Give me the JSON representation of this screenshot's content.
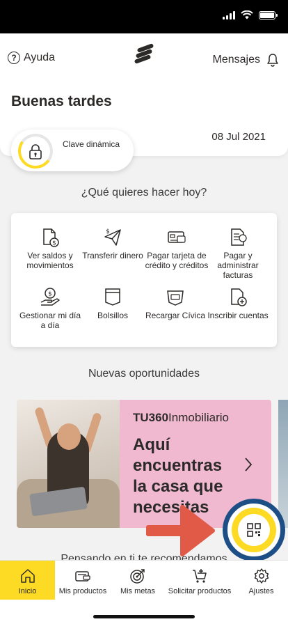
{
  "header": {
    "help_label": "Ayuda",
    "messages_label": "Mensajes",
    "greeting": "Buenas tardes",
    "date": "08 Jul 2021",
    "clave_label": "Clave dinámica"
  },
  "question": "¿Qué quieres hacer hoy?",
  "actions": [
    {
      "label": "Ver saldos y movimientos",
      "icon": "document-coin-icon"
    },
    {
      "label": "Transferir dinero",
      "icon": "paper-plane-icon"
    },
    {
      "label": "Pagar tarjeta de crédito y créditos",
      "icon": "credit-card-icon"
    },
    {
      "label": "Pagar y administrar facturas",
      "icon": "invoice-icon"
    },
    {
      "label": "Gestionar mi día a día",
      "icon": "hand-coin-icon"
    },
    {
      "label": "Bolsillos",
      "icon": "pocket-icon"
    },
    {
      "label": "Recargar Cívica",
      "icon": "civica-card-icon"
    },
    {
      "label": "Inscribir cuentas",
      "icon": "document-add-icon"
    }
  ],
  "oportunidades_title": "Nuevas oportunidades",
  "promo": {
    "brand_bold": "TU360",
    "brand_rest": "Inmobiliario",
    "title": "Aquí encuentras la casa que necesitas"
  },
  "recommend_title": "Pensando en ti te recomendamos",
  "tabbar": [
    {
      "label": "Inicio",
      "icon": "home-icon",
      "active": true
    },
    {
      "label": "Mis productos",
      "icon": "wallet-icon",
      "active": false
    },
    {
      "label": "Mis metas",
      "icon": "target-icon",
      "active": false
    },
    {
      "label": "Solicitar productos",
      "icon": "cart-plus-icon",
      "active": false
    },
    {
      "label": "Ajustes",
      "icon": "gear-icon",
      "active": false
    }
  ],
  "colors": {
    "accent_yellow": "#fdda24",
    "fab_ring": "#1d4f86",
    "promo_pink": "#f1b9d0",
    "arrow_red": "#e05a47"
  }
}
